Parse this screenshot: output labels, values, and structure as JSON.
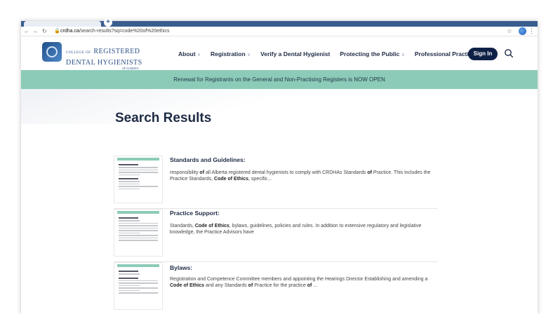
{
  "browser": {
    "url_domain": "crdha.ca",
    "url_path": "/search-results?sq=code%20of%20ethics"
  },
  "site": {
    "logo_small": "COLLEGE OF",
    "logo_registered": "REGISTERED",
    "logo_dental": "DENTAL HYGIENISTS",
    "logo_sub": "OF ALBERTA",
    "menu": [
      {
        "label": "About",
        "has_dropdown": true
      },
      {
        "label": "Registration",
        "has_dropdown": true
      },
      {
        "label": "Verify a Dental Hygienist",
        "has_dropdown": false
      },
      {
        "label": "Protecting the Public",
        "has_dropdown": true
      },
      {
        "label": "Professional Practice",
        "has_dropdown": true
      }
    ],
    "signin_label": "Sign In",
    "banner": "Renewal for Registrants on the General and Non-Practising Registers is NOW OPEN"
  },
  "page": {
    "title": "Search Results"
  },
  "results": [
    {
      "title": "Standards and Guidelines:",
      "desc_parts": [
        "responsibility ",
        "of",
        " all Alberta registered dental hygienists to comply with CRDHAs Standards ",
        "of",
        " Practice. This includes the Practice Standards, ",
        "Code of Ethics",
        ", specific..."
      ]
    },
    {
      "title": "Practice Support:",
      "desc_parts": [
        "Standards, ",
        "Code of Ethics",
        ", bylaws, guidelines, policies and rules. In addition to extensive regulatory and legislative knowledge, the Practice Advisors have"
      ]
    },
    {
      "title": "Bylaws:",
      "desc_parts": [
        "Registration and Competence Committee members and appointing the Hearings Director Establishing and amending a ",
        "Code of Ethics",
        " and any Standards ",
        "of",
        " Practice for the practice ",
        "of",
        " ..."
      ]
    }
  ],
  "colors": {
    "accent": "#8ccbb8",
    "navy": "#0f2146"
  }
}
